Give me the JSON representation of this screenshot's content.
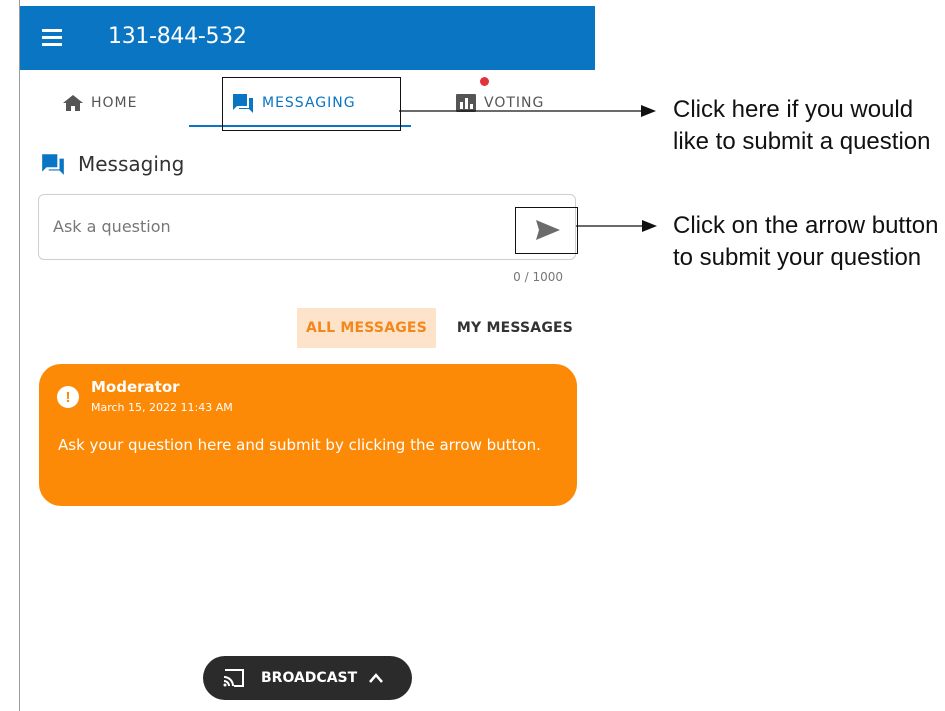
{
  "header": {
    "event_id": "131-844-532",
    "menu_icon": "hamburger-icon",
    "background": "#0a75c2"
  },
  "tabs": [
    {
      "label": "HOME",
      "icon": "home-icon"
    },
    {
      "label": "MESSAGING",
      "icon": "chat-icon",
      "active": true
    },
    {
      "label": "VOTING",
      "icon": "bar-chart-icon",
      "has_notification_dot": true
    }
  ],
  "section": {
    "title": "Messaging",
    "icon": "chat-icon"
  },
  "ask": {
    "placeholder": "Ask a question",
    "value": "",
    "counter": "0 / 1000",
    "send_icon": "send-arrow-icon"
  },
  "filters": {
    "all_label": "ALL MESSAGES",
    "mine_label": "MY MESSAGES",
    "active": "ALL MESSAGES"
  },
  "messages": [
    {
      "author": "Moderator",
      "timestamp": "March 15, 2022 11:43 AM",
      "text": "Ask your question here and submit by clicking the arrow button.",
      "icon": "alert-icon",
      "color": "#fd8a06"
    }
  ],
  "broadcast": {
    "label": "BROADCAST",
    "icon": "cast-icon",
    "chevron": "chevron-up-icon"
  },
  "annotations": [
    {
      "text": "Click here if you would like to submit a question"
    },
    {
      "text": "Click on the arrow button to submit your question"
    }
  ],
  "colors": {
    "accent": "#0a75c2",
    "orange": "#fd8a06",
    "dot": "#e0343a"
  }
}
